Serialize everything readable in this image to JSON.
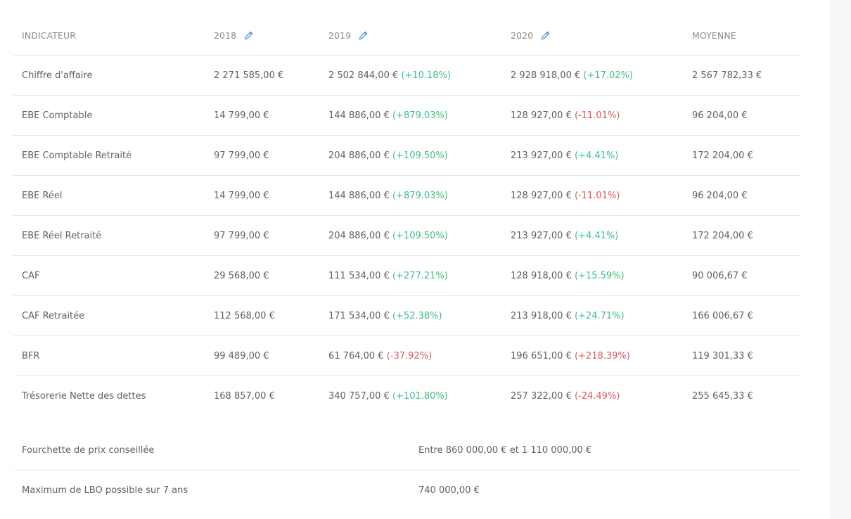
{
  "table": {
    "headers": {
      "indicator": "INDICATEUR",
      "y2018": "2018",
      "y2019": "2019",
      "y2020": "2020",
      "average": "MOYENNE"
    },
    "rows": [
      {
        "label": "Chiffre d'affaire",
        "v2018": "2 271 585,00 €",
        "v2019": "2 502 844,00 €",
        "d2019": "(+10.18%)",
        "v2020": "2 928 918,00 €",
        "d2020": "(+17.02%)",
        "avg": "2 567 782,33 €"
      },
      {
        "label": "EBE Comptable",
        "v2018": "14 799,00 €",
        "v2019": "144 886,00 €",
        "d2019": "(+879.03%)",
        "v2020": "128 927,00 €",
        "d2020": "(-11.01%)",
        "avg": "96 204,00 €"
      },
      {
        "label": "EBE Comptable Retraité",
        "v2018": "97 799,00 €",
        "v2019": "204 886,00 €",
        "d2019": "(+109.50%)",
        "v2020": "213 927,00 €",
        "d2020": "(+4.41%)",
        "avg": "172 204,00 €"
      },
      {
        "label": "EBE Réel",
        "v2018": "14 799,00 €",
        "v2019": "144 886,00 €",
        "d2019": "(+879.03%)",
        "v2020": "128 927,00 €",
        "d2020": "(-11.01%)",
        "avg": "96 204,00 €"
      },
      {
        "label": "EBE Réel Retraité",
        "v2018": "97 799,00 €",
        "v2019": "204 886,00 €",
        "d2019": "(+109.50%)",
        "v2020": "213 927,00 €",
        "d2020": "(+4.41%)",
        "avg": "172 204,00 €"
      },
      {
        "label": "CAF",
        "v2018": "29 568,00 €",
        "v2019": "111 534,00 €",
        "d2019": "(+277.21%)",
        "v2020": "128 918,00 €",
        "d2020": "(+15.59%)",
        "avg": "90 006,67 €"
      },
      {
        "label": "CAF Retraitée",
        "v2018": "112 568,00 €",
        "v2019": "171 534,00 €",
        "d2019": "(+52.38%)",
        "v2020": "213 918,00 €",
        "d2020": "(+24.71%)",
        "avg": "166 006,67 €"
      },
      {
        "label": "BFR",
        "v2018": "99 489,00 €",
        "v2019": "61 764,00 €",
        "d2019": "(-37.92%)",
        "v2020": "196 651,00 €",
        "d2020": "(+218.39%)",
        "avg": "119 301,33 €"
      },
      {
        "label": "Trésorerie Nette des dettes",
        "v2018": "168 857,00 €",
        "v2019": "340 757,00 €",
        "d2019": "(+101.80%)",
        "v2020": "257 322,00 €",
        "d2020": "(-24.49%)",
        "avg": "255 645,33 €"
      }
    ]
  },
  "summary": {
    "price_range_label": "Fourchette de prix conseillée",
    "price_range_value": "Entre 860 000,00 € et 1 110 000,00 €",
    "lbo_label": "Maximum de LBO possible sur 7 ans",
    "lbo_value": "740 000,00 €"
  },
  "colors": {
    "positive": "#3fbf7f",
    "negative": "#e05565",
    "pencil": "#3a8fd9"
  },
  "icons": {
    "edit": "pencil-icon"
  }
}
